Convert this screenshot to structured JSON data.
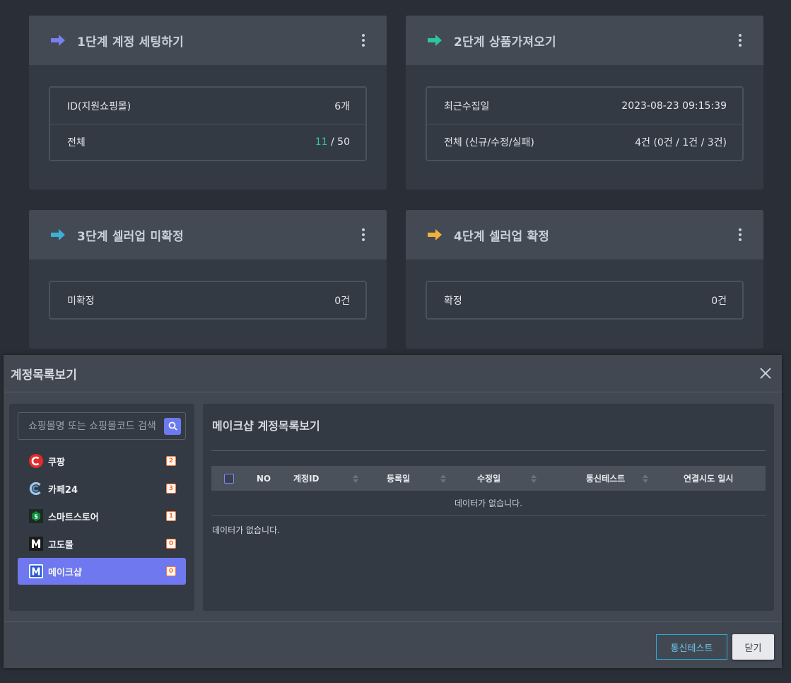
{
  "cards": [
    {
      "title": "1단계 계정 세팅하기",
      "arrow_color": "#7a7ff0",
      "rows": [
        {
          "label": "ID(지원쇼핑몰)",
          "value": "6개"
        },
        {
          "label": "전체",
          "value_highlight": "11",
          "value_rest": " / 50"
        }
      ]
    },
    {
      "title": "2단계 상품가져오기",
      "arrow_color": "#2ec4a0",
      "rows": [
        {
          "label": "최근수집일",
          "value": "2023-08-23 09:15:39"
        },
        {
          "label": "전체 (신규/수정/실패)",
          "value": "4건 (0건 / 1건 / 3건)"
        }
      ]
    },
    {
      "title": "3단계 셀러업 미확정",
      "arrow_color": "#3cb1d8",
      "rows": [
        {
          "label": "미확정",
          "value": "0건"
        }
      ]
    },
    {
      "title": "4단계 셀러업 확정",
      "arrow_color": "#f4b13a",
      "rows": [
        {
          "label": "확정",
          "value": "0건"
        }
      ]
    }
  ],
  "modal": {
    "title": "계정목록보기",
    "search_placeholder": "쇼핑몰명 또는 쇼핑몰코드 검색",
    "malls": [
      {
        "name": "쿠팡",
        "count": "2",
        "icon": "coupang-logo-icon",
        "active": false
      },
      {
        "name": "카페24",
        "count": "3",
        "icon": "cafe24-logo-icon",
        "active": false
      },
      {
        "name": "스마트스토어",
        "count": "1",
        "icon": "smartstore-logo-icon",
        "active": false
      },
      {
        "name": "고도몰",
        "count": "0",
        "icon": "godomall-logo-icon",
        "active": false
      },
      {
        "name": "메이크샵",
        "count": "0",
        "icon": "makeshop-logo-icon",
        "active": true
      }
    ],
    "panel_title": "메이크샵 계정목록보기",
    "columns": [
      "NO",
      "계정ID",
      "등록일",
      "수정일",
      "통신테스트",
      "연결시도 일시"
    ],
    "empty_message": "데이터가 없습니다.",
    "below_message": "데이터가 없습니다.",
    "buttons": {
      "test": "통신테스트",
      "close": "닫기"
    }
  },
  "colors": {
    "accent": "#6f78ee",
    "green": "#2ec4a0",
    "badge": "#ff6a2a"
  }
}
